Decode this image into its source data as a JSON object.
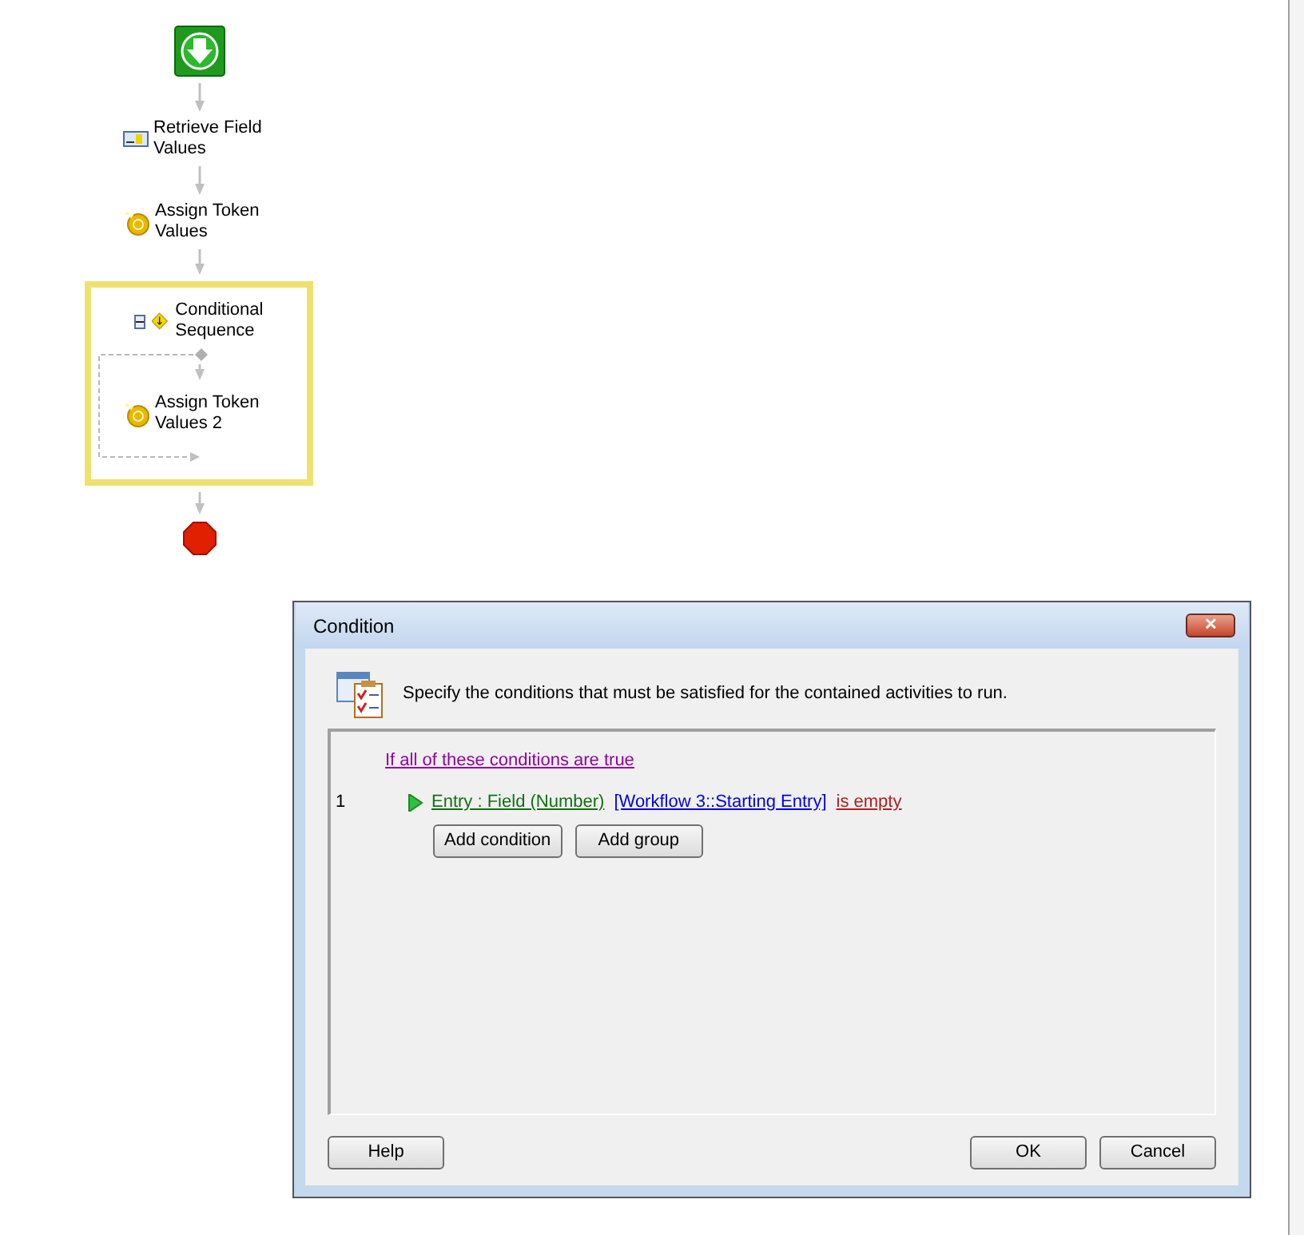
{
  "workflow": {
    "nodes": [
      {
        "kind": "start"
      },
      {
        "kind": "retrieve",
        "label": "Retrieve Field Values"
      },
      {
        "kind": "token",
        "label": "Assign Token Values"
      },
      {
        "kind": "conditional",
        "label": "Conditional Sequence",
        "expanded": true,
        "selected": true,
        "children": [
          {
            "kind": "token",
            "label": "Assign Token Values 2"
          }
        ]
      },
      {
        "kind": "end"
      }
    ]
  },
  "dialog": {
    "title": "Condition",
    "close": "✕",
    "description": "Specify the conditions that must be satisfied for the contained activities to run.",
    "group_label": "If all of these conditions are true",
    "conditions": [
      {
        "number": "1",
        "field": "Entry : Field (Number)",
        "value": "[Workflow 3::Starting Entry]",
        "operator": "is empty"
      }
    ],
    "add_buttons": [
      "Add condition",
      "Add group"
    ],
    "buttons": [
      {
        "label": "Help",
        "kind": "left"
      },
      {
        "label": "OK",
        "kind": "right"
      },
      {
        "label": "Cancel",
        "kind": "right"
      }
    ]
  }
}
